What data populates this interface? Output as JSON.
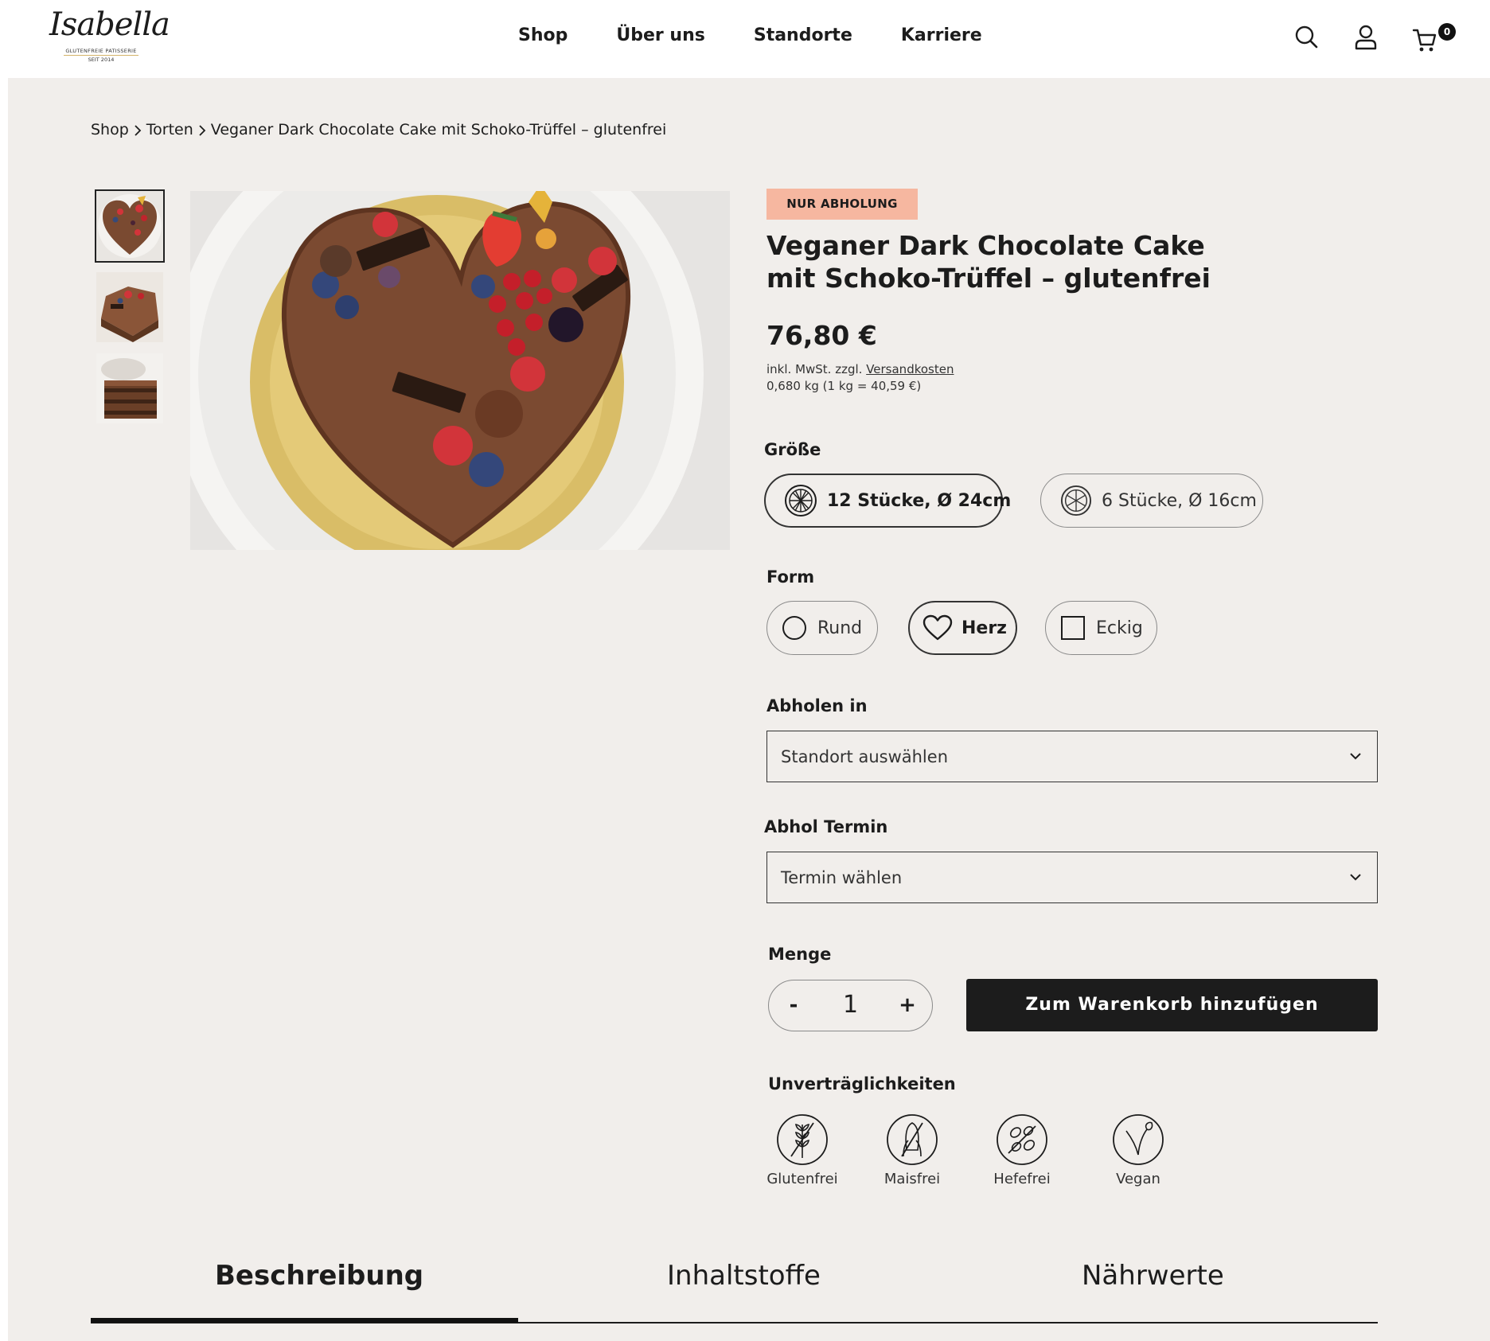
{
  "header": {
    "logo": {
      "script": "Isabella",
      "tagline": "GLUTENFREIE PATISSERIE",
      "since": "SEIT 2014"
    },
    "nav": [
      "Shop",
      "Über uns",
      "Standorte",
      "Karriere"
    ],
    "cart_count": "0",
    "icons": [
      "search-icon",
      "user-icon",
      "cart-icon"
    ]
  },
  "breadcrumb": [
    "Shop",
    "Torten",
    "Veganer Dark Chocolate Cake mit Schoko-Trüffel – glutenfrei"
  ],
  "product": {
    "badge": "NUR ABHOLUNG",
    "title": "Veganer Dark Chocolate Cake mit Schoko-Trüffel – glutenfrei",
    "price": "76,80 €",
    "tax_prefix": "inkl. MwSt. zzgl. ",
    "tax_link": "Versandkosten",
    "unit_price": "0,680 kg (1 kg = 40,59 €)"
  },
  "size": {
    "label": "Größe",
    "options": [
      {
        "label": "12 Stücke, Ø 24cm",
        "selected": true,
        "icon": "cake-12-icon"
      },
      {
        "label": "6 Stücke, Ø 16cm",
        "selected": false,
        "icon": "cake-6-icon"
      }
    ]
  },
  "form": {
    "label": "Form",
    "options": [
      {
        "label": "Rund",
        "selected": false,
        "icon": "circle-icon"
      },
      {
        "label": "Herz",
        "selected": true,
        "icon": "heart-icon"
      },
      {
        "label": "Eckig",
        "selected": false,
        "icon": "square-icon"
      }
    ]
  },
  "pickup_location": {
    "label": "Abholen in",
    "value": "Standort auswählen"
  },
  "pickup_date": {
    "label": "Abhol Termin",
    "value": "Termin wählen"
  },
  "quantity": {
    "label": "Menge",
    "minus": "-",
    "value": "1",
    "plus": "+"
  },
  "add_to_cart": "Zum Warenkorb hinzufügen",
  "allergens": {
    "label": "Unverträglichkeiten",
    "items": [
      {
        "label": "Glutenfrei",
        "icon": "wheat-crossed-icon"
      },
      {
        "label": "Maisfrei",
        "icon": "corn-crossed-icon"
      },
      {
        "label": "Hefefrei",
        "icon": "yeast-crossed-icon"
      },
      {
        "label": "Vegan",
        "icon": "leaf-icon"
      }
    ]
  },
  "tabs": [
    {
      "label": "Beschreibung",
      "active": true
    },
    {
      "label": "Inhaltstoffe",
      "active": false
    },
    {
      "label": "Nährwerte",
      "active": false
    }
  ],
  "colors": {
    "badge_bg": "#f6b7a0",
    "page_bg": "#f1eeeb",
    "button_bg": "#1c1c1c"
  }
}
